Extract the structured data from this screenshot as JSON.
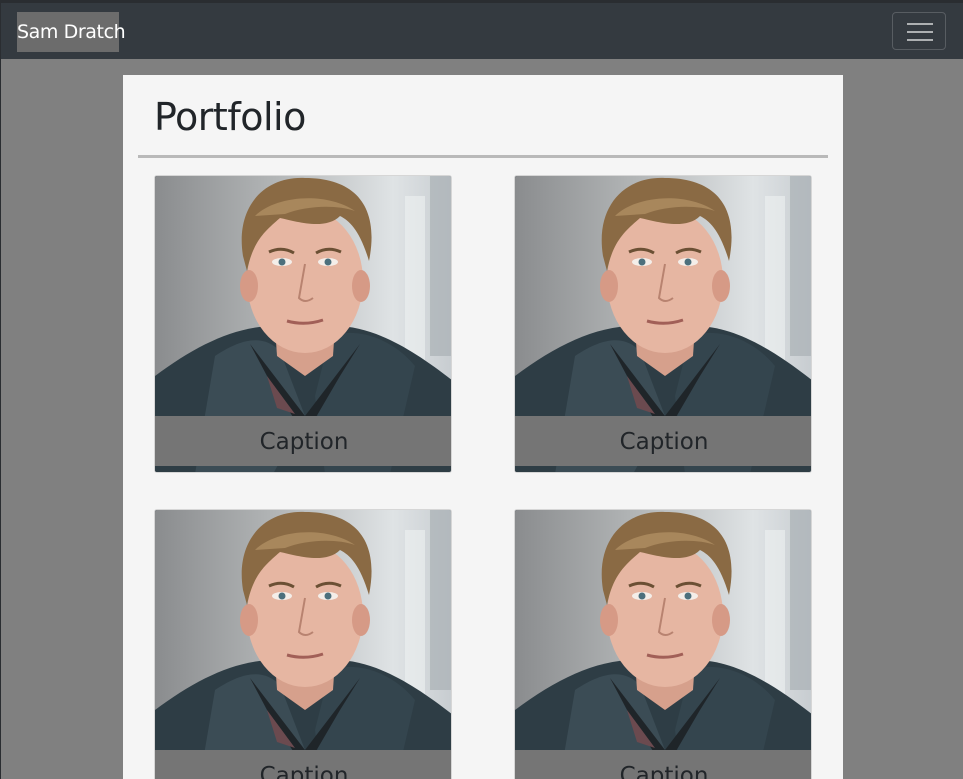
{
  "navbar": {
    "brand": "Sam Dratch",
    "toggler_icon": "hamburger-menu-icon",
    "bg_color": "#343a40"
  },
  "page": {
    "title": "Portfolio"
  },
  "gallery": {
    "items": [
      {
        "caption": "Caption",
        "image": "portrait-photo"
      },
      {
        "caption": "Caption",
        "image": "portrait-photo"
      },
      {
        "caption": "Caption",
        "image": "portrait-photo"
      },
      {
        "caption": "Caption",
        "image": "portrait-photo"
      }
    ]
  }
}
